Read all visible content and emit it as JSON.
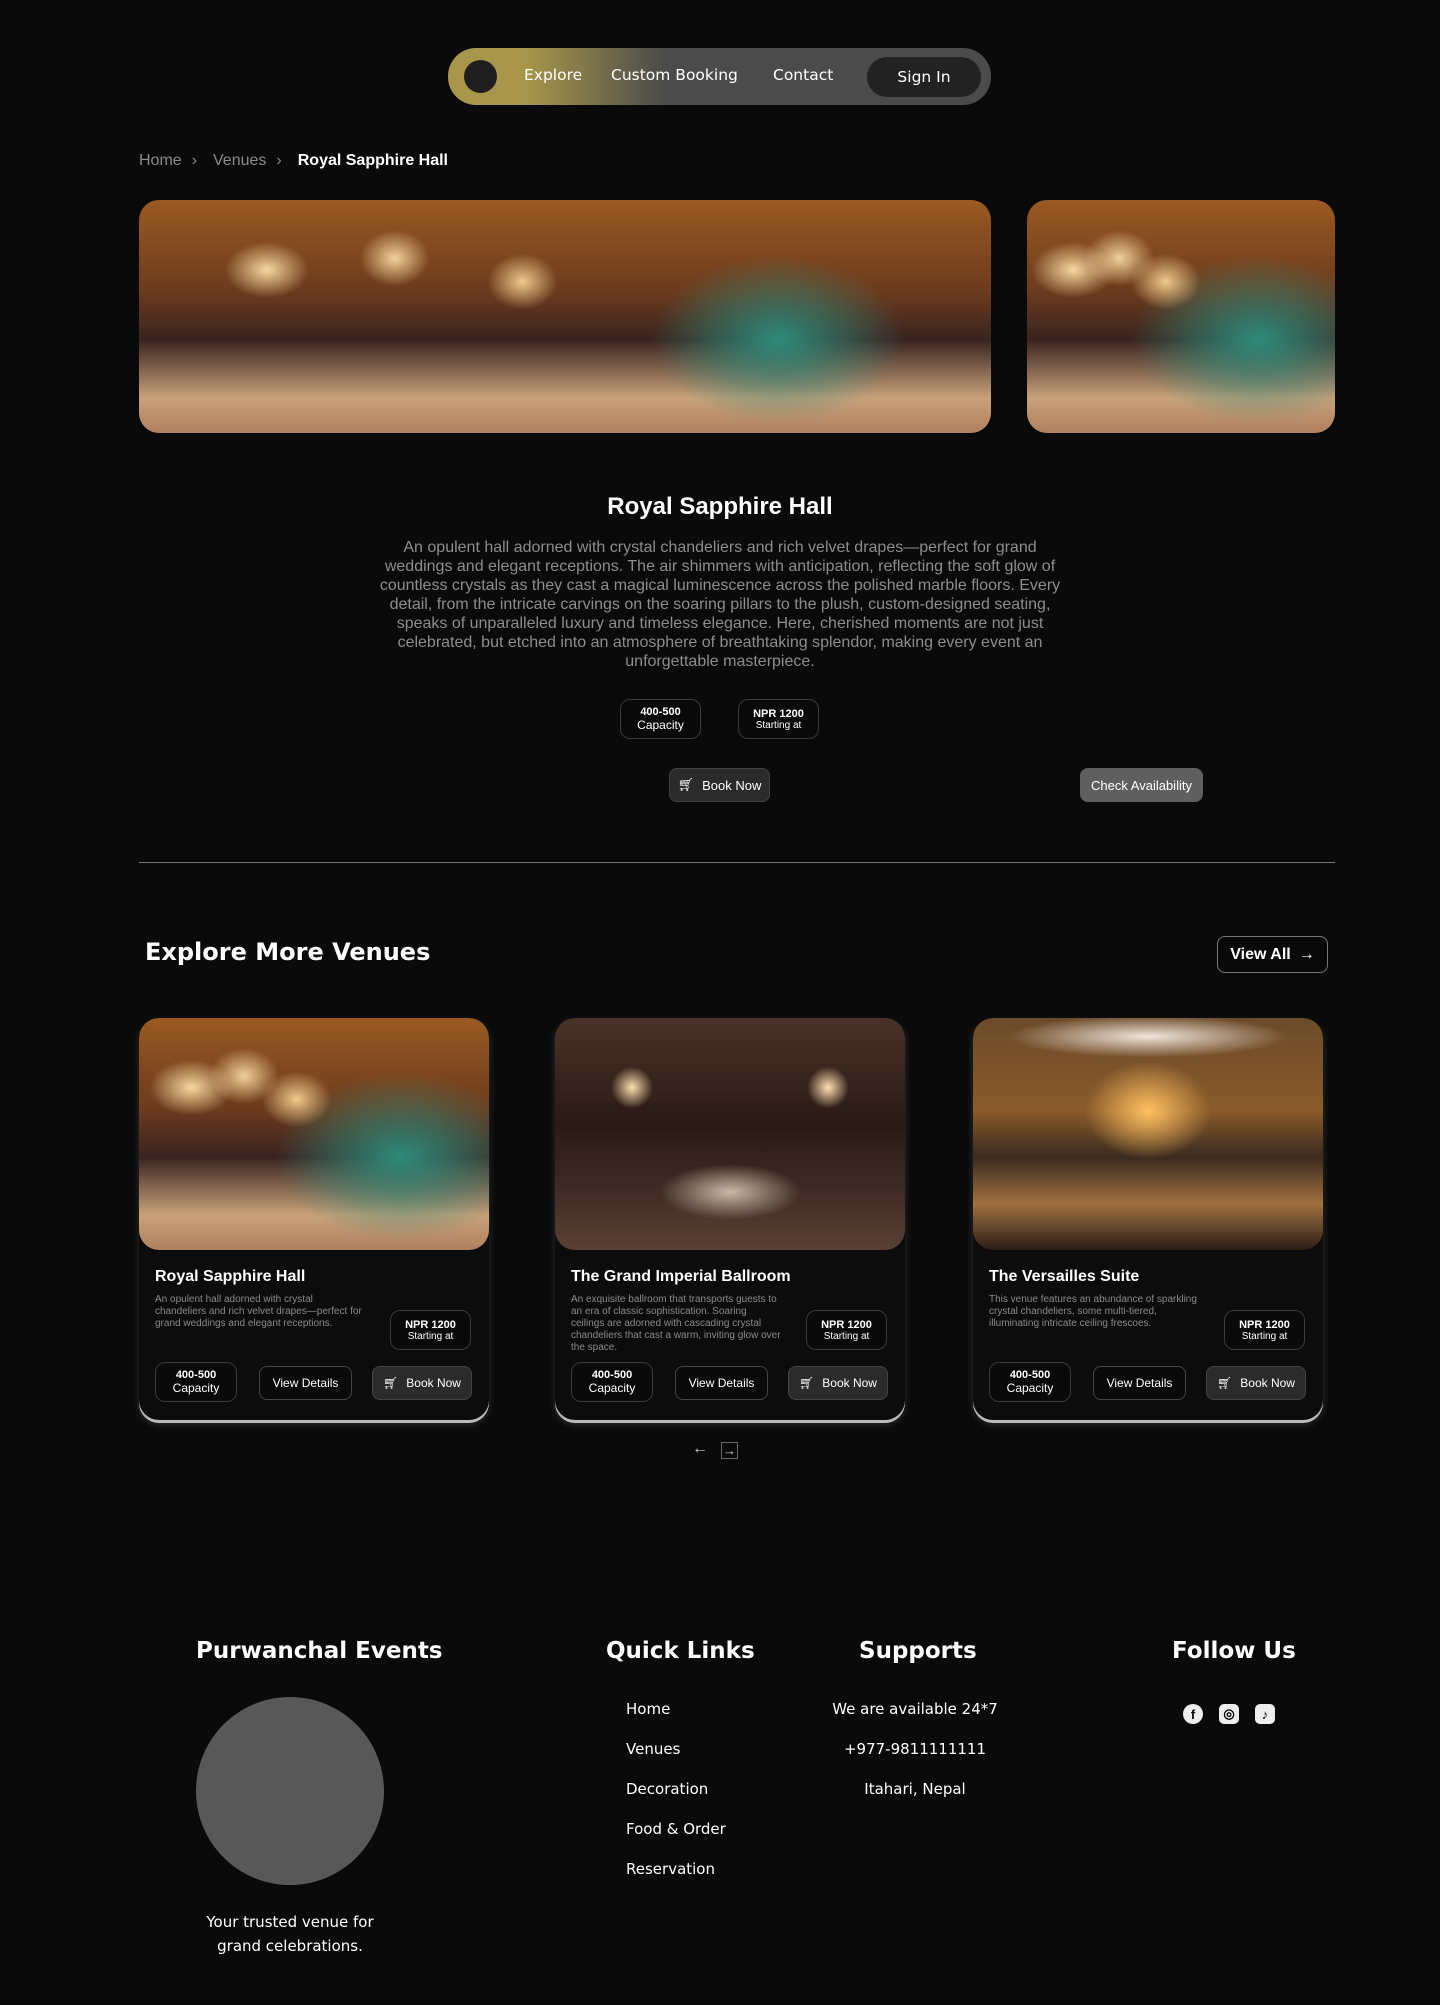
{
  "nav": {
    "items": [
      "Explore",
      "Custom Booking",
      "Contact"
    ],
    "sign_in": "Sign In"
  },
  "breadcrumb": [
    "Home",
    "Venues",
    "Royal Sapphire Hall"
  ],
  "venue": {
    "title": "Royal Sapphire Hall",
    "description": "An opulent hall adorned with crystal chandeliers and rich velvet drapes—perfect for grand weddings and elegant receptions. The air shimmers with anticipation, reflecting the soft glow of countless crystals as they cast a magical luminescence across the polished marble floors. Every detail, from the intricate carvings on the soaring pillars to the plush, custom-designed seating, speaks of unparalleled luxury and timeless elegance. Here, cherished moments are not just celebrated, but etched into an atmosphere of breathtaking splendor, making every event an unforgettable masterpiece.",
    "capacity": "400-500",
    "capacity_label": "Capacity",
    "price": "NPR 1200",
    "price_label": "Starting at",
    "book_now": "Book Now",
    "check_availability": "Check Availability"
  },
  "explore": {
    "title": "Explore More Venues",
    "view_all": "View All",
    "cards": [
      {
        "title": "Royal Sapphire Hall",
        "description": "An opulent hall adorned with crystal chandeliers and rich velvet drapes—perfect for grand weddings and elegant receptions.",
        "price": "NPR 1200",
        "price_label": "Starting at",
        "capacity": "400-500",
        "capacity_label": "Capacity",
        "view_details": "View Details",
        "book_now": "Book Now"
      },
      {
        "title": "The Grand Imperial Ballroom",
        "description": "An exquisite ballroom that transports guests to an era of classic sophistication. Soaring ceilings are adorned with cascading crystal chandeliers that cast a warm, inviting glow over the space.",
        "price": "NPR 1200",
        "price_label": "Starting at",
        "capacity": "400-500",
        "capacity_label": "Capacity",
        "view_details": "View Details",
        "book_now": "Book Now"
      },
      {
        "title": "The Versailles Suite",
        "description": "This venue features an abundance of sparkling crystal chandeliers, some multi-tiered, illuminating intricate ceiling frescoes.",
        "price": "NPR 1200",
        "price_label": "Starting at",
        "capacity": "400-500",
        "capacity_label": "Capacity",
        "view_details": "View Details",
        "book_now": "Book Now"
      }
    ]
  },
  "footer": {
    "brand": "Purwanchal Events",
    "tagline": "Your trusted venue for grand celebrations.",
    "quick_links_title": "Quick Links",
    "quick_links": [
      "Home",
      "Venues",
      "Decoration",
      "Food & Order",
      "Reservation"
    ],
    "supports_title": "Supports",
    "supports": [
      "We are available 24*7",
      "+977-9811111111",
      "Itahari, Nepal"
    ],
    "follow_title": "Follow Us",
    "social_icons": [
      "facebook-icon",
      "instagram-icon",
      "tiktok-icon"
    ]
  },
  "colors": {
    "background": "#0a0a0a",
    "nav_gold": "#a8974a",
    "nav_gray": "#4b4b4b",
    "check_btn": "#5f5f5f"
  }
}
